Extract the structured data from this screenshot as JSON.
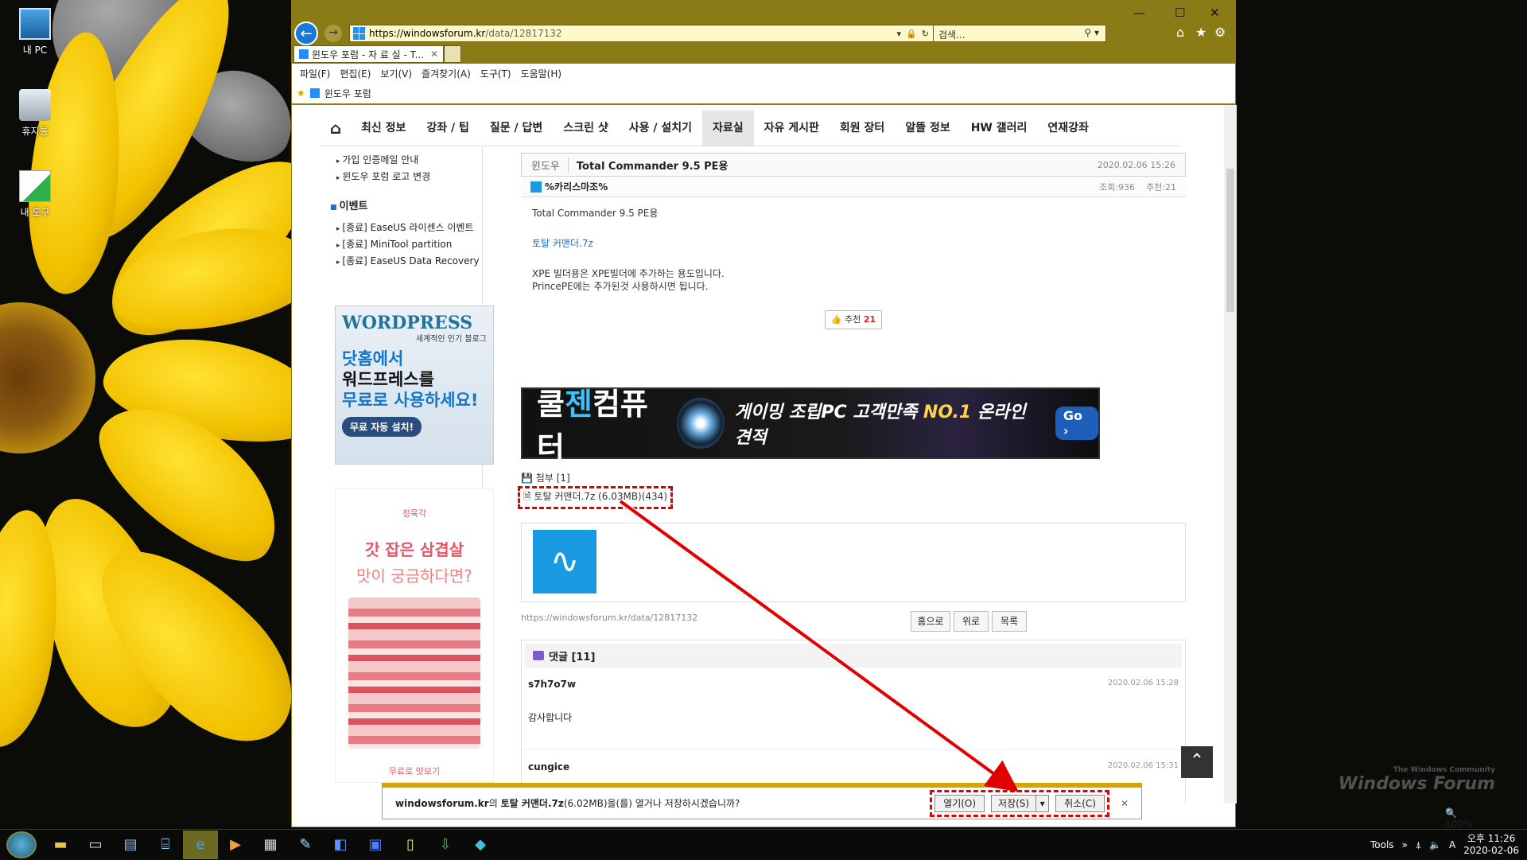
{
  "desktop": {
    "icons": [
      {
        "label": "내 PC"
      },
      {
        "label": "휴지통"
      },
      {
        "label": "내 도구"
      }
    ],
    "watermark": {
      "small": "The Windows Community",
      "big": "Windows Forum"
    }
  },
  "browser": {
    "url_host": "https://windowsforum.kr",
    "url_path": "/data/12817132",
    "search_placeholder": "검색...",
    "tab_title": "윈도우 포럼 - 자 료 실 - T...",
    "menu": [
      "파일(F)",
      "편집(E)",
      "보기(V)",
      "즐겨찾기(A)",
      "도구(T)",
      "도움말(H)"
    ],
    "favorites": [
      "윈도우 포럼"
    ],
    "zoom": "100%"
  },
  "nav": {
    "items": [
      "최신 정보",
      "강좌 / 팁",
      "질문 / 답변",
      "스크린 샷",
      "사용 / 설치기",
      "자료실",
      "자유 게시판",
      "회원 장터",
      "알뜰 정보",
      "HW 갤러리",
      "연재강좌"
    ],
    "active": "자료실"
  },
  "sidebar": {
    "links_top": [
      "가입 인증메일 안내",
      "윈도우 포럼 로고 변경"
    ],
    "event_heading": "이벤트",
    "events": [
      "[종료] EaseUS 라이센스 이벤트",
      "[종료] MiniTool partition",
      "[종료] EaseUS Data Recovery"
    ],
    "ad_wp": {
      "logo": "WORDPRESS",
      "sub": "세계적인 인기 블로그",
      "line1": "닷홈에서",
      "line2": "워드프레스를",
      "line3": "무료로 사용하세요!",
      "btn": "무료 자동 설치!"
    },
    "ad_pork": {
      "brand": "정육각",
      "line1": "갓 잡은 삼겹살",
      "line2": "맛이 궁금하다면?",
      "cta": "무료로 맛보기"
    }
  },
  "article": {
    "category": "윈도우",
    "title": "Total Commander 9.5 PE용",
    "date": "2020.02.06 15:26",
    "author": "%카리스마조%",
    "views": "조회:936",
    "recommend": "추천:21",
    "body": [
      "Total Commander 9.5 PE용",
      "토탈 커맨더.7z",
      "XPE 빌더용은 XPE빌더에 추가하는 용도입니다.",
      "PrincePE에는 추가된것 사용하시면 됩니다."
    ],
    "vote_label": "추천",
    "vote_count": "21",
    "attach_label": "첨부 [1]",
    "attach_file": "토탈 커맨더.7z (6.03MB)(434)",
    "permalink": "https://windowsforum.kr/data/12817132",
    "buttons": [
      "홈으로",
      "위로",
      "목록"
    ]
  },
  "ad_cool": {
    "brand_a": "쿨",
    "brand_b": "젠",
    "brand_c": "컴퓨터",
    "slogan_a": "게이밍 조립PC 고객만족 ",
    "slogan_b": "NO.1",
    "slogan_c": " 온라인 견적",
    "go": "Go"
  },
  "comments": {
    "header": "댓글 [11]",
    "items": [
      {
        "author": "s7h7o7w",
        "date": "2020.02.06 15:28",
        "text": "감사합니다"
      },
      {
        "author": "cungice",
        "date": "2020.02.06 15:31",
        "text": ""
      }
    ]
  },
  "download_bar": {
    "host": "windowsforum.kr",
    "mid": "의 ",
    "file": "토탈 커맨더.7z",
    "rest": "(6.02MB)을(를) 열거나 저장하시겠습니까?",
    "open": "열기(O)",
    "save": "저장(S)",
    "cancel": "취소(C)"
  },
  "taskbar": {
    "tools": "Tools",
    "ime": "A",
    "time": "오후 11:26",
    "date": "2020-02-06"
  }
}
